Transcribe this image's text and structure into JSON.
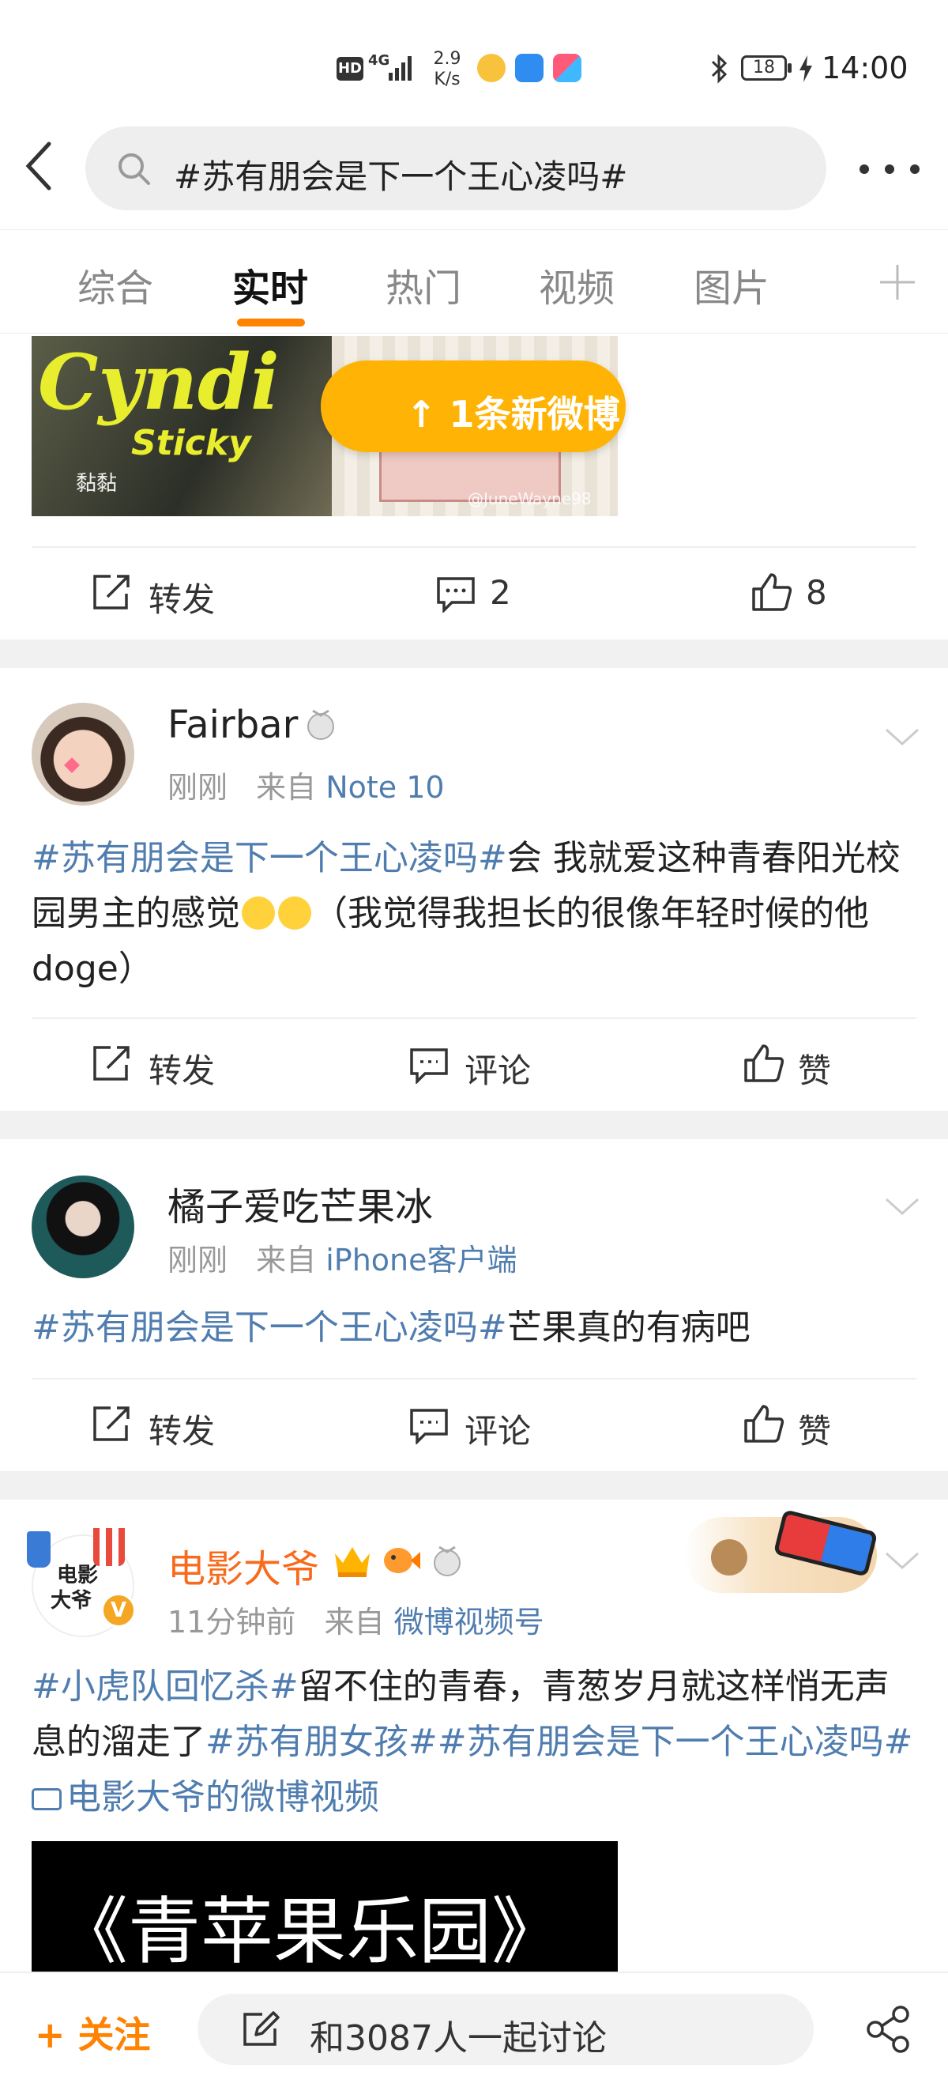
{
  "status_bar": {
    "hd": "HD",
    "network": "4G",
    "speed_value": "2.9",
    "speed_unit": "K/s",
    "battery": "18",
    "time": "14:00"
  },
  "search": {
    "query": "#苏有朋会是下一个王心凌吗#"
  },
  "tabs": [
    {
      "label": "综合"
    },
    {
      "label": "实时"
    },
    {
      "label": "热门"
    },
    {
      "label": "视频"
    },
    {
      "label": "图片"
    }
  ],
  "new_posts_button": "↑ 1条新微博",
  "post0": {
    "image_text": "Cyndi",
    "image_subtext": "Sticky",
    "image_cn": "黏黏",
    "watermark": "@JuneWayne98",
    "repost_label": "转发",
    "comment_count": "2",
    "like_count": "8"
  },
  "post1": {
    "username": "Fairbar",
    "time": "刚刚",
    "from_label": "来自",
    "source": "Note 10",
    "hashtag": "#苏有朋会是下一个王心凌吗#",
    "text": "会 我就爱这种青春阳光校园男主的感觉",
    "text2": "（我觉得我担长的很像年轻时候的他doge）",
    "repost_label": "转发",
    "comment_label": "评论",
    "like_label": "赞"
  },
  "post2": {
    "username": "橘子爱吃芒果冰",
    "time": "刚刚",
    "from_label": "来自",
    "source": "iPhone客户端",
    "hashtag": "#苏有朋会是下一个王心凌吗#",
    "text": "芒果真的有病吧",
    "repost_label": "转发",
    "comment_label": "评论",
    "like_label": "赞"
  },
  "post3": {
    "username": "电影大爷",
    "time": "11分钟前",
    "from_label": "来自",
    "source": "微博视频号",
    "avatar_text_1": "电影",
    "avatar_text_2": "大爷",
    "hashtag1": "#小虎队回忆杀#",
    "text1": "留不住的青春，青葱岁月就这样悄无声息的溜走了",
    "hashtag2": "#苏有朋女孩#",
    "hashtag3": "#苏有朋会是下一个王心凌吗#",
    "video_link": "电影大爷的微博视频",
    "video_title": "《青苹果乐园》"
  },
  "bottom_bar": {
    "follow": "+ 关注",
    "discuss": "和3087人一起讨论"
  },
  "colors": {
    "accent": "#ff8200",
    "link": "#507daf",
    "new_button": "#ffb405"
  }
}
